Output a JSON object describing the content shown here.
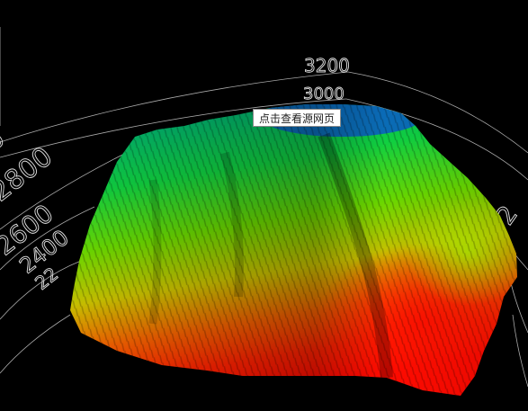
{
  "scene": {
    "elevation_labels_back": [
      "3200",
      "3000"
    ],
    "elevation_labels_left": [
      "2800",
      "2600",
      "2400",
      "22"
    ],
    "elevation_labels_right": [
      "2"
    ],
    "colors": {
      "background": "#000000",
      "grid": "#c8c8c8",
      "low": "#ff1a00",
      "mid": "#7dff00",
      "high": "#0a5cc8"
    }
  },
  "tooltip": {
    "text": "点击查看源网页"
  }
}
